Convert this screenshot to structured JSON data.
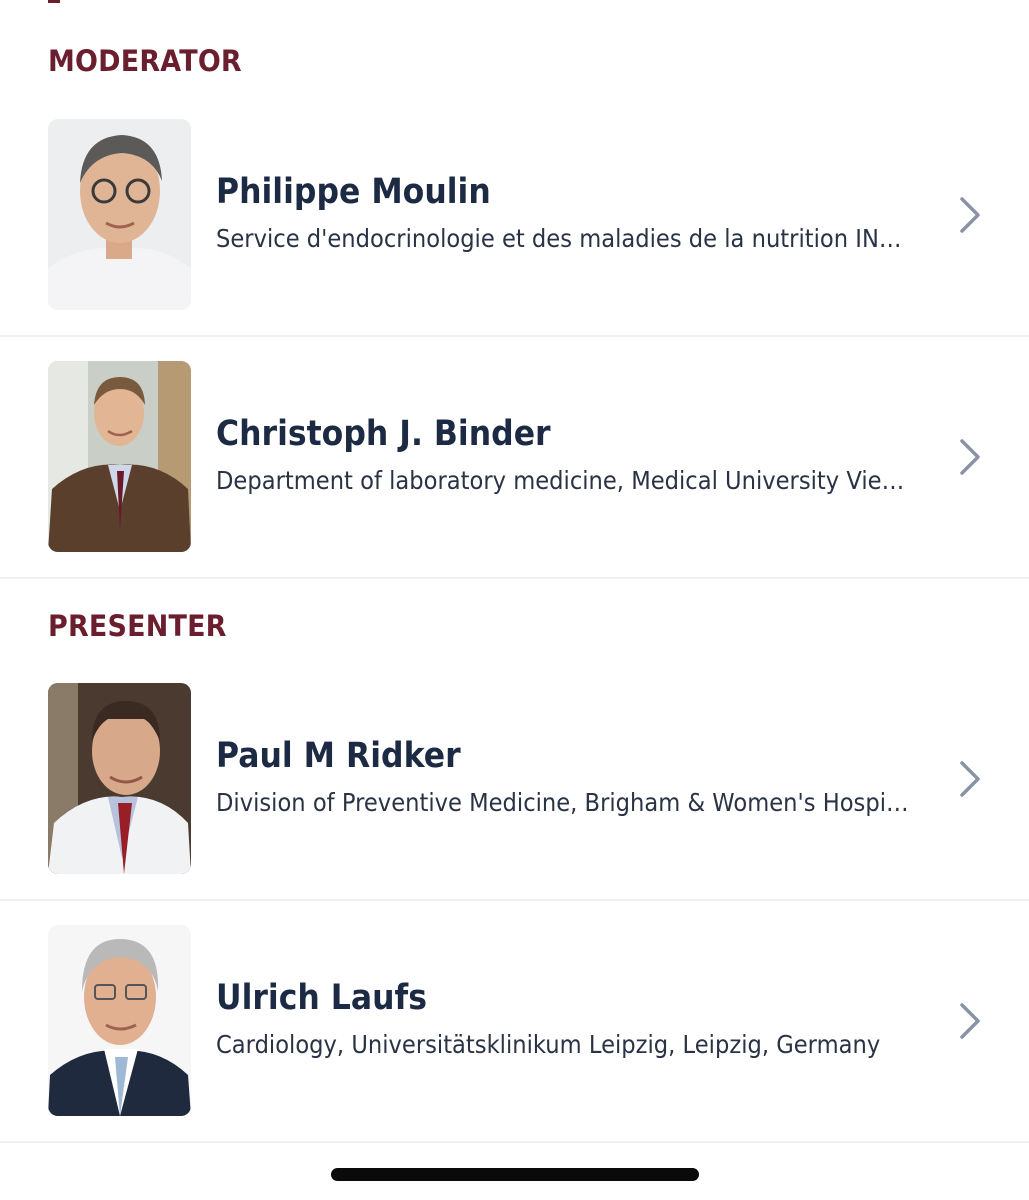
{
  "sections": [
    {
      "heading": "MODERATOR",
      "people": [
        {
          "name": "Philippe Moulin",
          "affiliation": "Service d'endocrinologie et des maladies de la nutrition IN…",
          "avatar_icon": "person-photo"
        },
        {
          "name": "Christoph J. Binder",
          "affiliation": "Department of laboratory medicine, Medical University Vie…",
          "avatar_icon": "person-photo"
        }
      ]
    },
    {
      "heading": "PRESENTER",
      "people": [
        {
          "name": "Paul M Ridker",
          "affiliation": "Division of Preventive Medicine, Brigham & Women's Hospi…",
          "avatar_icon": "person-photo"
        },
        {
          "name": "Ulrich Laufs",
          "affiliation": "Cardiology, Universitätsklinikum Leipzig, Leipzig, Germany",
          "avatar_icon": "person-photo"
        }
      ]
    }
  ],
  "colors": {
    "section_heading": "#6b1f2e",
    "name": "#1c2a44",
    "affiliation": "#2a3345",
    "chevron": "#8a93a6",
    "separator": "#eef0f3"
  },
  "icons": {
    "row_arrow": "chevron-right-icon"
  }
}
